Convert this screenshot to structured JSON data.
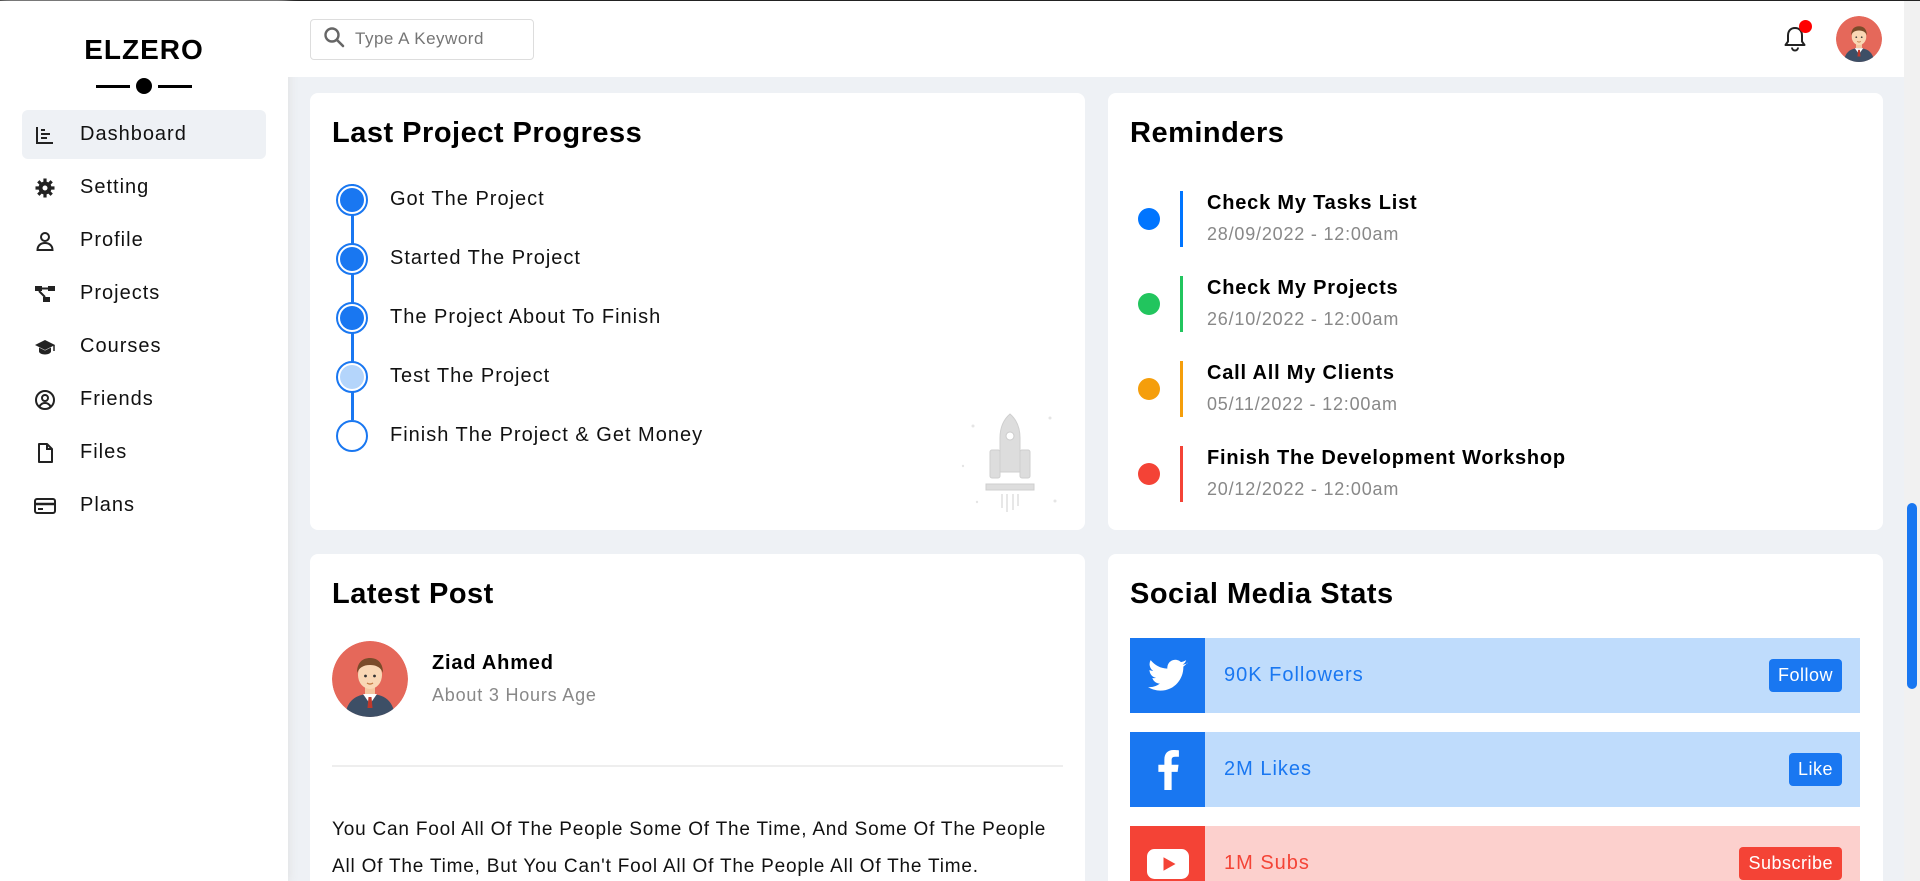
{
  "brand": {
    "name": "ELZERO"
  },
  "sidebar": {
    "items": [
      {
        "label": "Dashboard",
        "icon": "chart-icon",
        "active": true
      },
      {
        "label": "Setting",
        "icon": "gear-icon"
      },
      {
        "label": "Profile",
        "icon": "user-icon"
      },
      {
        "label": "Projects",
        "icon": "diagram-icon"
      },
      {
        "label": "Courses",
        "icon": "graduation-cap-icon"
      },
      {
        "label": "Friends",
        "icon": "circle-user-icon"
      },
      {
        "label": "Files",
        "icon": "file-icon"
      },
      {
        "label": "Plans",
        "icon": "credit-card-icon"
      }
    ]
  },
  "header": {
    "search_placeholder": "Type A Keyword",
    "notification_badge": true
  },
  "progress": {
    "title": "Last Project Progress",
    "steps": [
      {
        "label": "Got The Project",
        "state": "done"
      },
      {
        "label": "Started The Project",
        "state": "done"
      },
      {
        "label": "The Project About To Finish",
        "state": "done"
      },
      {
        "label": "Test The Project",
        "state": "current"
      },
      {
        "label": "Finish The Project & Get Money",
        "state": "pending"
      }
    ]
  },
  "reminders": {
    "title": "Reminders",
    "items": [
      {
        "title": "Check My Tasks List",
        "date": "28/09/2022 - 12:00am",
        "color": "#0075ff"
      },
      {
        "title": "Check My Projects",
        "date": "26/10/2022 - 12:00am",
        "color": "#22c55e"
      },
      {
        "title": "Call All My Clients",
        "date": "05/11/2022 - 12:00am",
        "color": "#f59e0b"
      },
      {
        "title": "Finish The Development Workshop",
        "date": "20/12/2022 - 12:00am",
        "color": "#f44336"
      }
    ]
  },
  "latest_post": {
    "title": "Latest Post",
    "author": "Ziad Ahmed",
    "time": "About 3 Hours Age",
    "text": "You Can Fool All Of The People Some Of The Time, And Some Of The People All Of The Time, But You Can't Fool All Of The People All Of The Time."
  },
  "social": {
    "title": "Social Media Stats",
    "items": [
      {
        "network": "twitter",
        "icon": "twitter-icon",
        "text": "90K Followers",
        "button": "Follow",
        "color": "#1977f1",
        "bg": "#bfdcfc"
      },
      {
        "network": "facebook",
        "icon": "facebook-icon",
        "text": "2M Likes",
        "button": "Like",
        "color": "#1977f1",
        "bg": "#bfdcfc"
      },
      {
        "network": "youtube",
        "icon": "youtube-icon",
        "text": "1M Subs",
        "button": "Subscribe",
        "color": "#f44336",
        "bg": "#fcd0cd"
      }
    ]
  },
  "colors": {
    "accent": "#1977f1"
  }
}
